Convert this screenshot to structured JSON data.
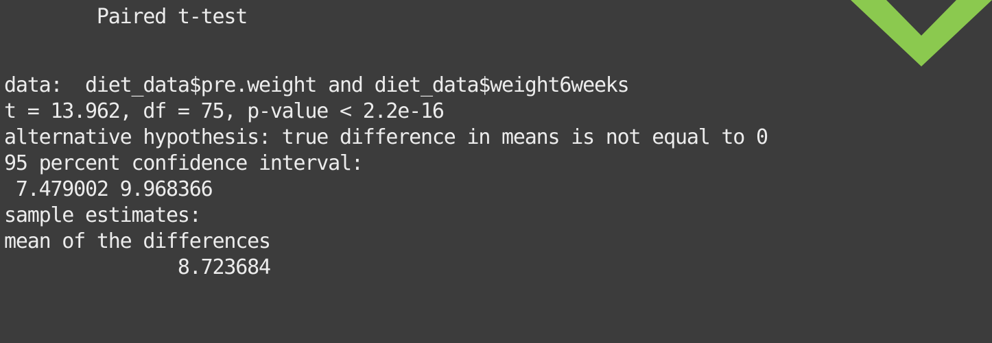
{
  "output": {
    "lines": [
      "        Paired t-test",
      "data:  diet_data$pre.weight and diet_data$weight6weeks",
      "t = 13.962, df = 75, p-value < 2.2e-16",
      "alternative hypothesis: true difference in means is not equal to 0",
      "95 percent confidence interval:",
      " 7.479002 9.968366",
      "sample estimates:",
      "mean of the differences",
      "               8.723684"
    ]
  },
  "badge": {
    "icon": "checkmark-icon",
    "color": "#8bc94f"
  },
  "colors": {
    "background": "#3c3c3c",
    "text": "#ececec"
  }
}
